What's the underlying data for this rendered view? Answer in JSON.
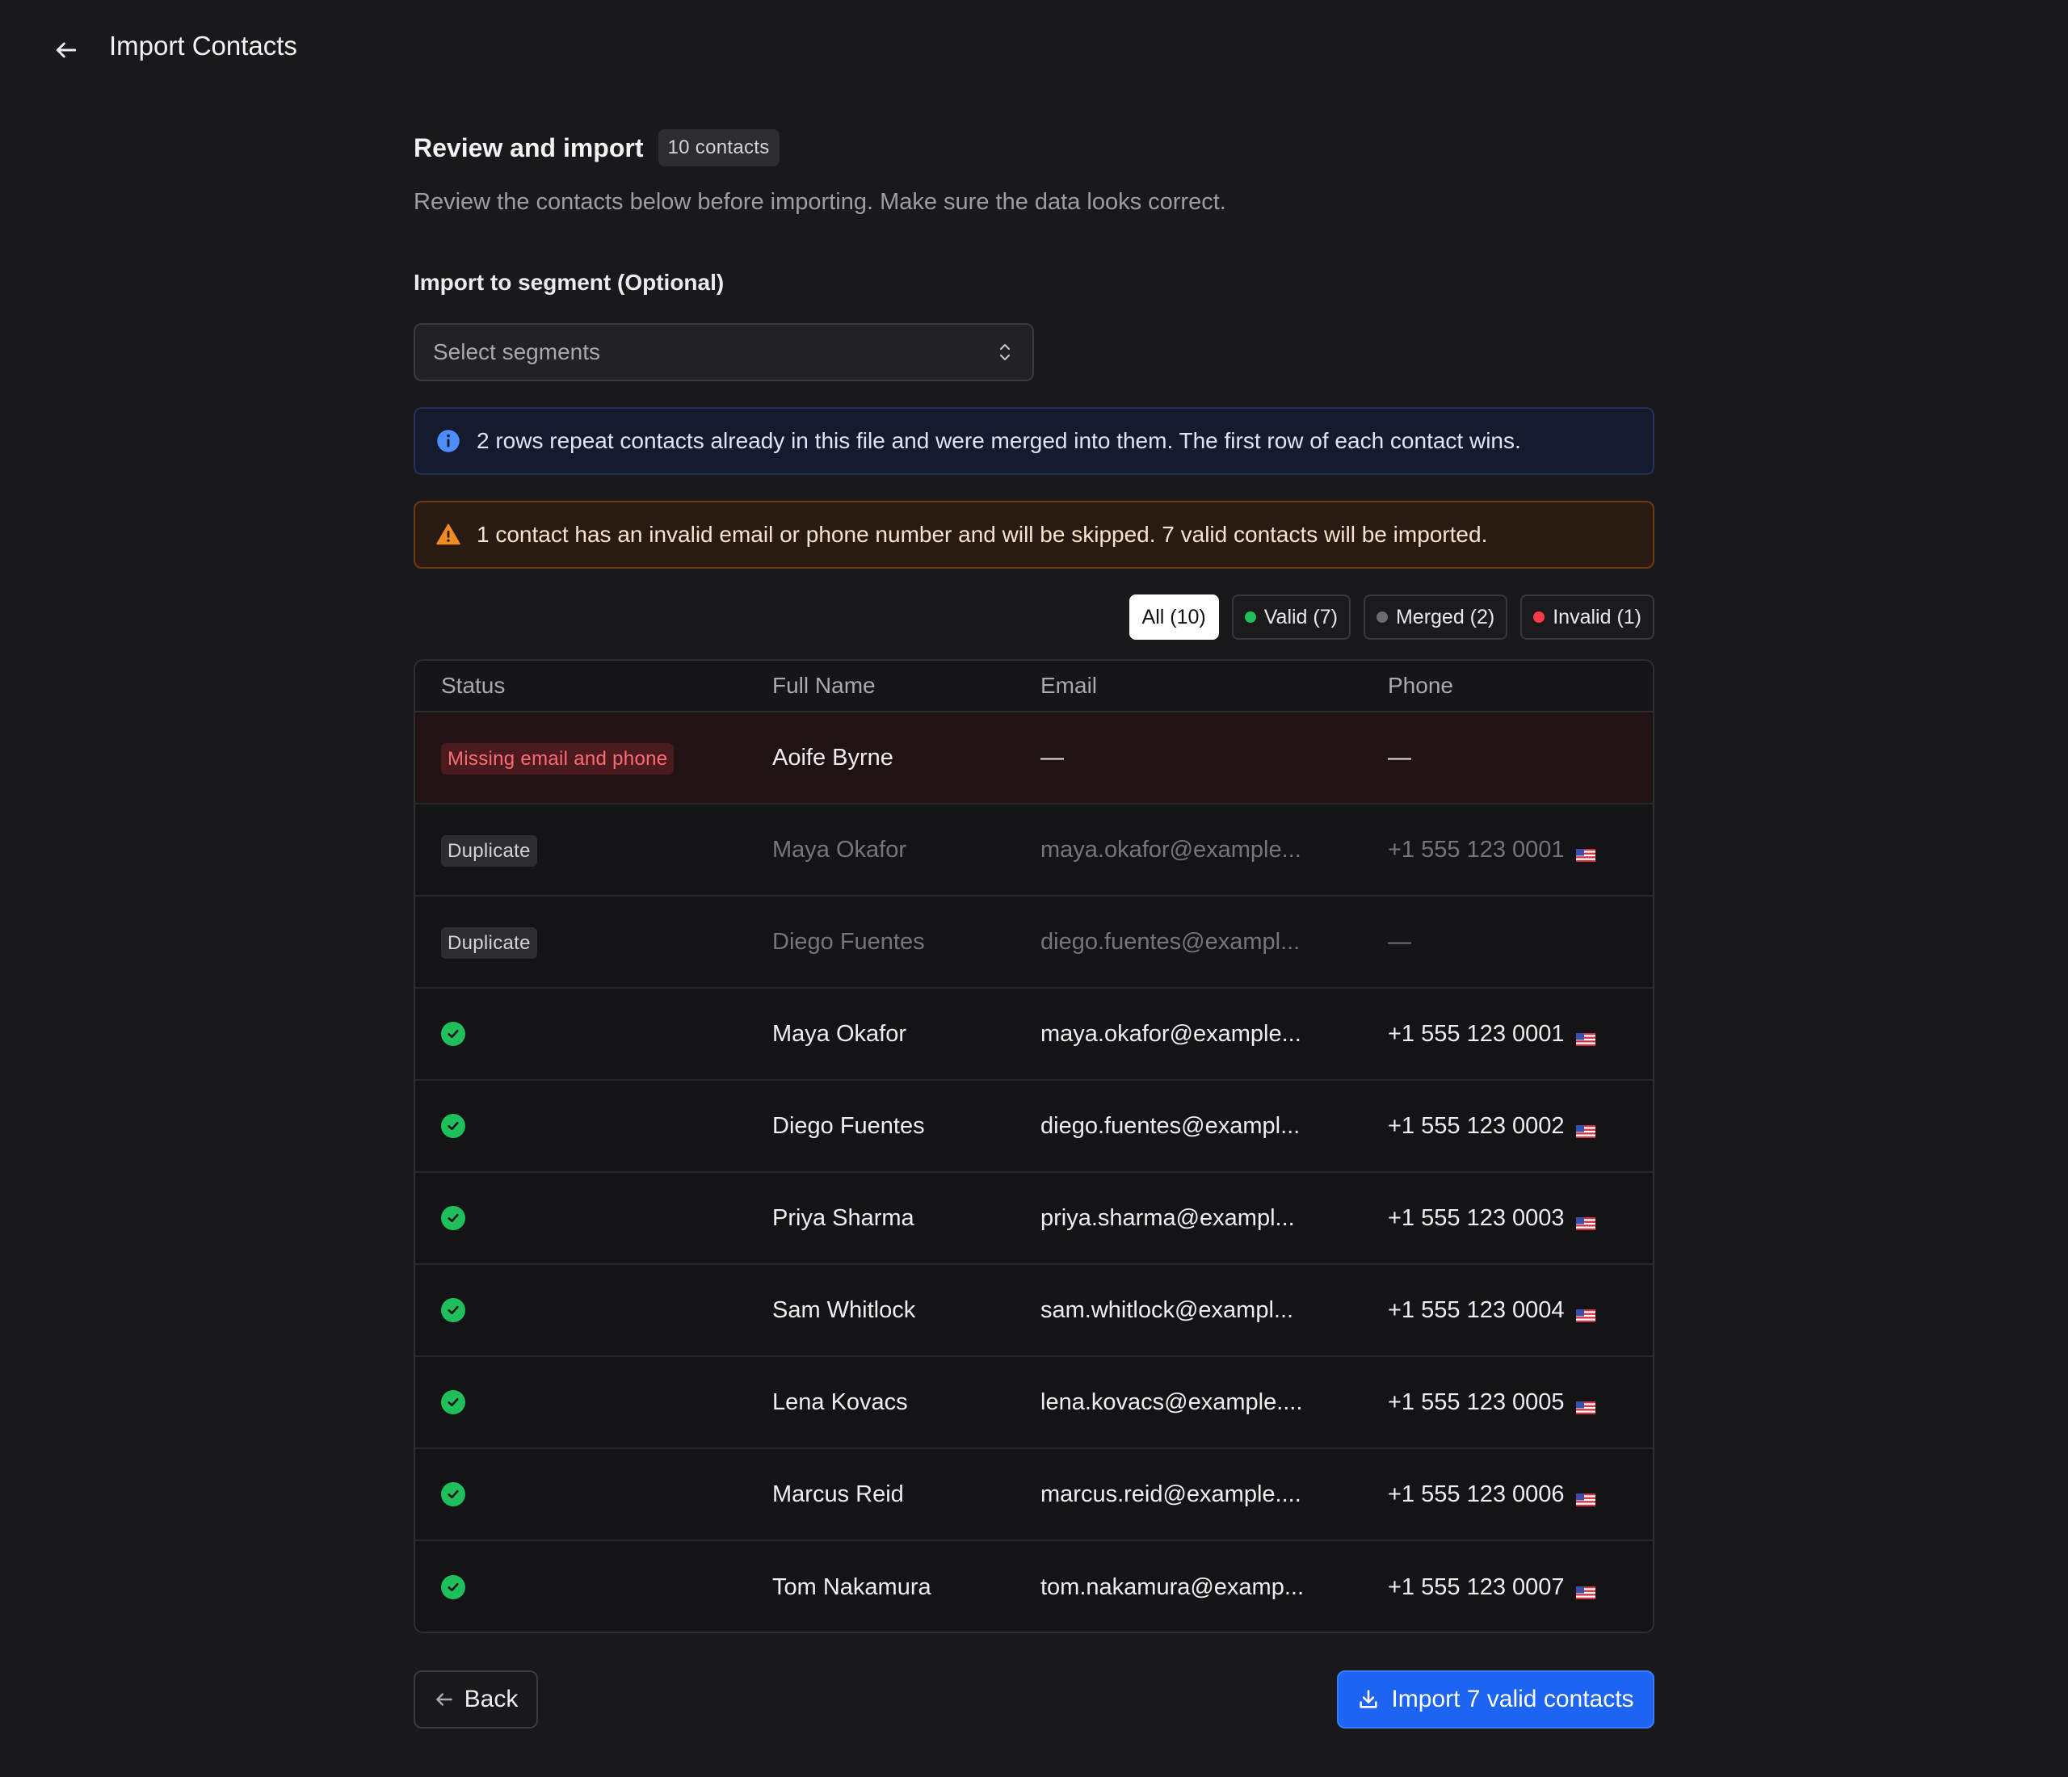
{
  "header": {
    "title": "Import Contacts"
  },
  "review": {
    "title": "Review and import",
    "count_badge": "10 contacts",
    "subtitle": "Review the contacts below before importing. Make sure the data looks correct."
  },
  "segment": {
    "label": "Import to segment (Optional)",
    "placeholder": "Select segments"
  },
  "banners": {
    "info": "2 rows repeat contacts already in this file and were merged into them. The first row of each contact wins.",
    "warning": "1 contact has an invalid email or phone number and will be skipped. 7 valid contacts will be imported."
  },
  "filters": {
    "all": "All (10)",
    "valid": "Valid (7)",
    "merged": "Merged (2)",
    "invalid": "Invalid (1)"
  },
  "colors": {
    "accent": "#1d64f2",
    "valid": "#1fc05b",
    "merged": "#6b6b72",
    "invalid": "#ff3b4a",
    "warning": "#f08a24",
    "info": "#4c8dff"
  },
  "table": {
    "headers": {
      "status": "Status",
      "name": "Full Name",
      "email": "Email",
      "phone": "Phone"
    },
    "rows": [
      {
        "status": "Missing email and phone",
        "name": "Aoife Byrne",
        "email": "—",
        "phone": "—"
      },
      {
        "status": "Duplicate",
        "name": "Maya Okafor",
        "email": "maya.okafor@example...",
        "phone": "+1 555 123 0001"
      },
      {
        "status": "Duplicate",
        "name": "Diego Fuentes",
        "email": "diego.fuentes@exampl...",
        "phone": "—"
      },
      {
        "status": "valid",
        "name": "Maya Okafor",
        "email": "maya.okafor@example...",
        "phone": "+1 555 123 0001"
      },
      {
        "status": "valid",
        "name": "Diego Fuentes",
        "email": "diego.fuentes@exampl...",
        "phone": "+1 555 123 0002"
      },
      {
        "status": "valid",
        "name": "Priya Sharma",
        "email": "priya.sharma@exampl...",
        "phone": "+1 555 123 0003"
      },
      {
        "status": "valid",
        "name": "Sam Whitlock",
        "email": "sam.whitlock@exampl...",
        "phone": "+1 555 123 0004"
      },
      {
        "status": "valid",
        "name": "Lena Kovacs",
        "email": "lena.kovacs@example....",
        "phone": "+1 555 123 0005"
      },
      {
        "status": "valid",
        "name": "Marcus Reid",
        "email": "marcus.reid@example....",
        "phone": "+1 555 123 0006"
      },
      {
        "status": "valid",
        "name": "Tom Nakamura",
        "email": "tom.nakamura@examp...",
        "phone": "+1 555 123 0007"
      }
    ]
  },
  "footer": {
    "back_label": "Back",
    "import_label": "Import 7 valid contacts"
  }
}
